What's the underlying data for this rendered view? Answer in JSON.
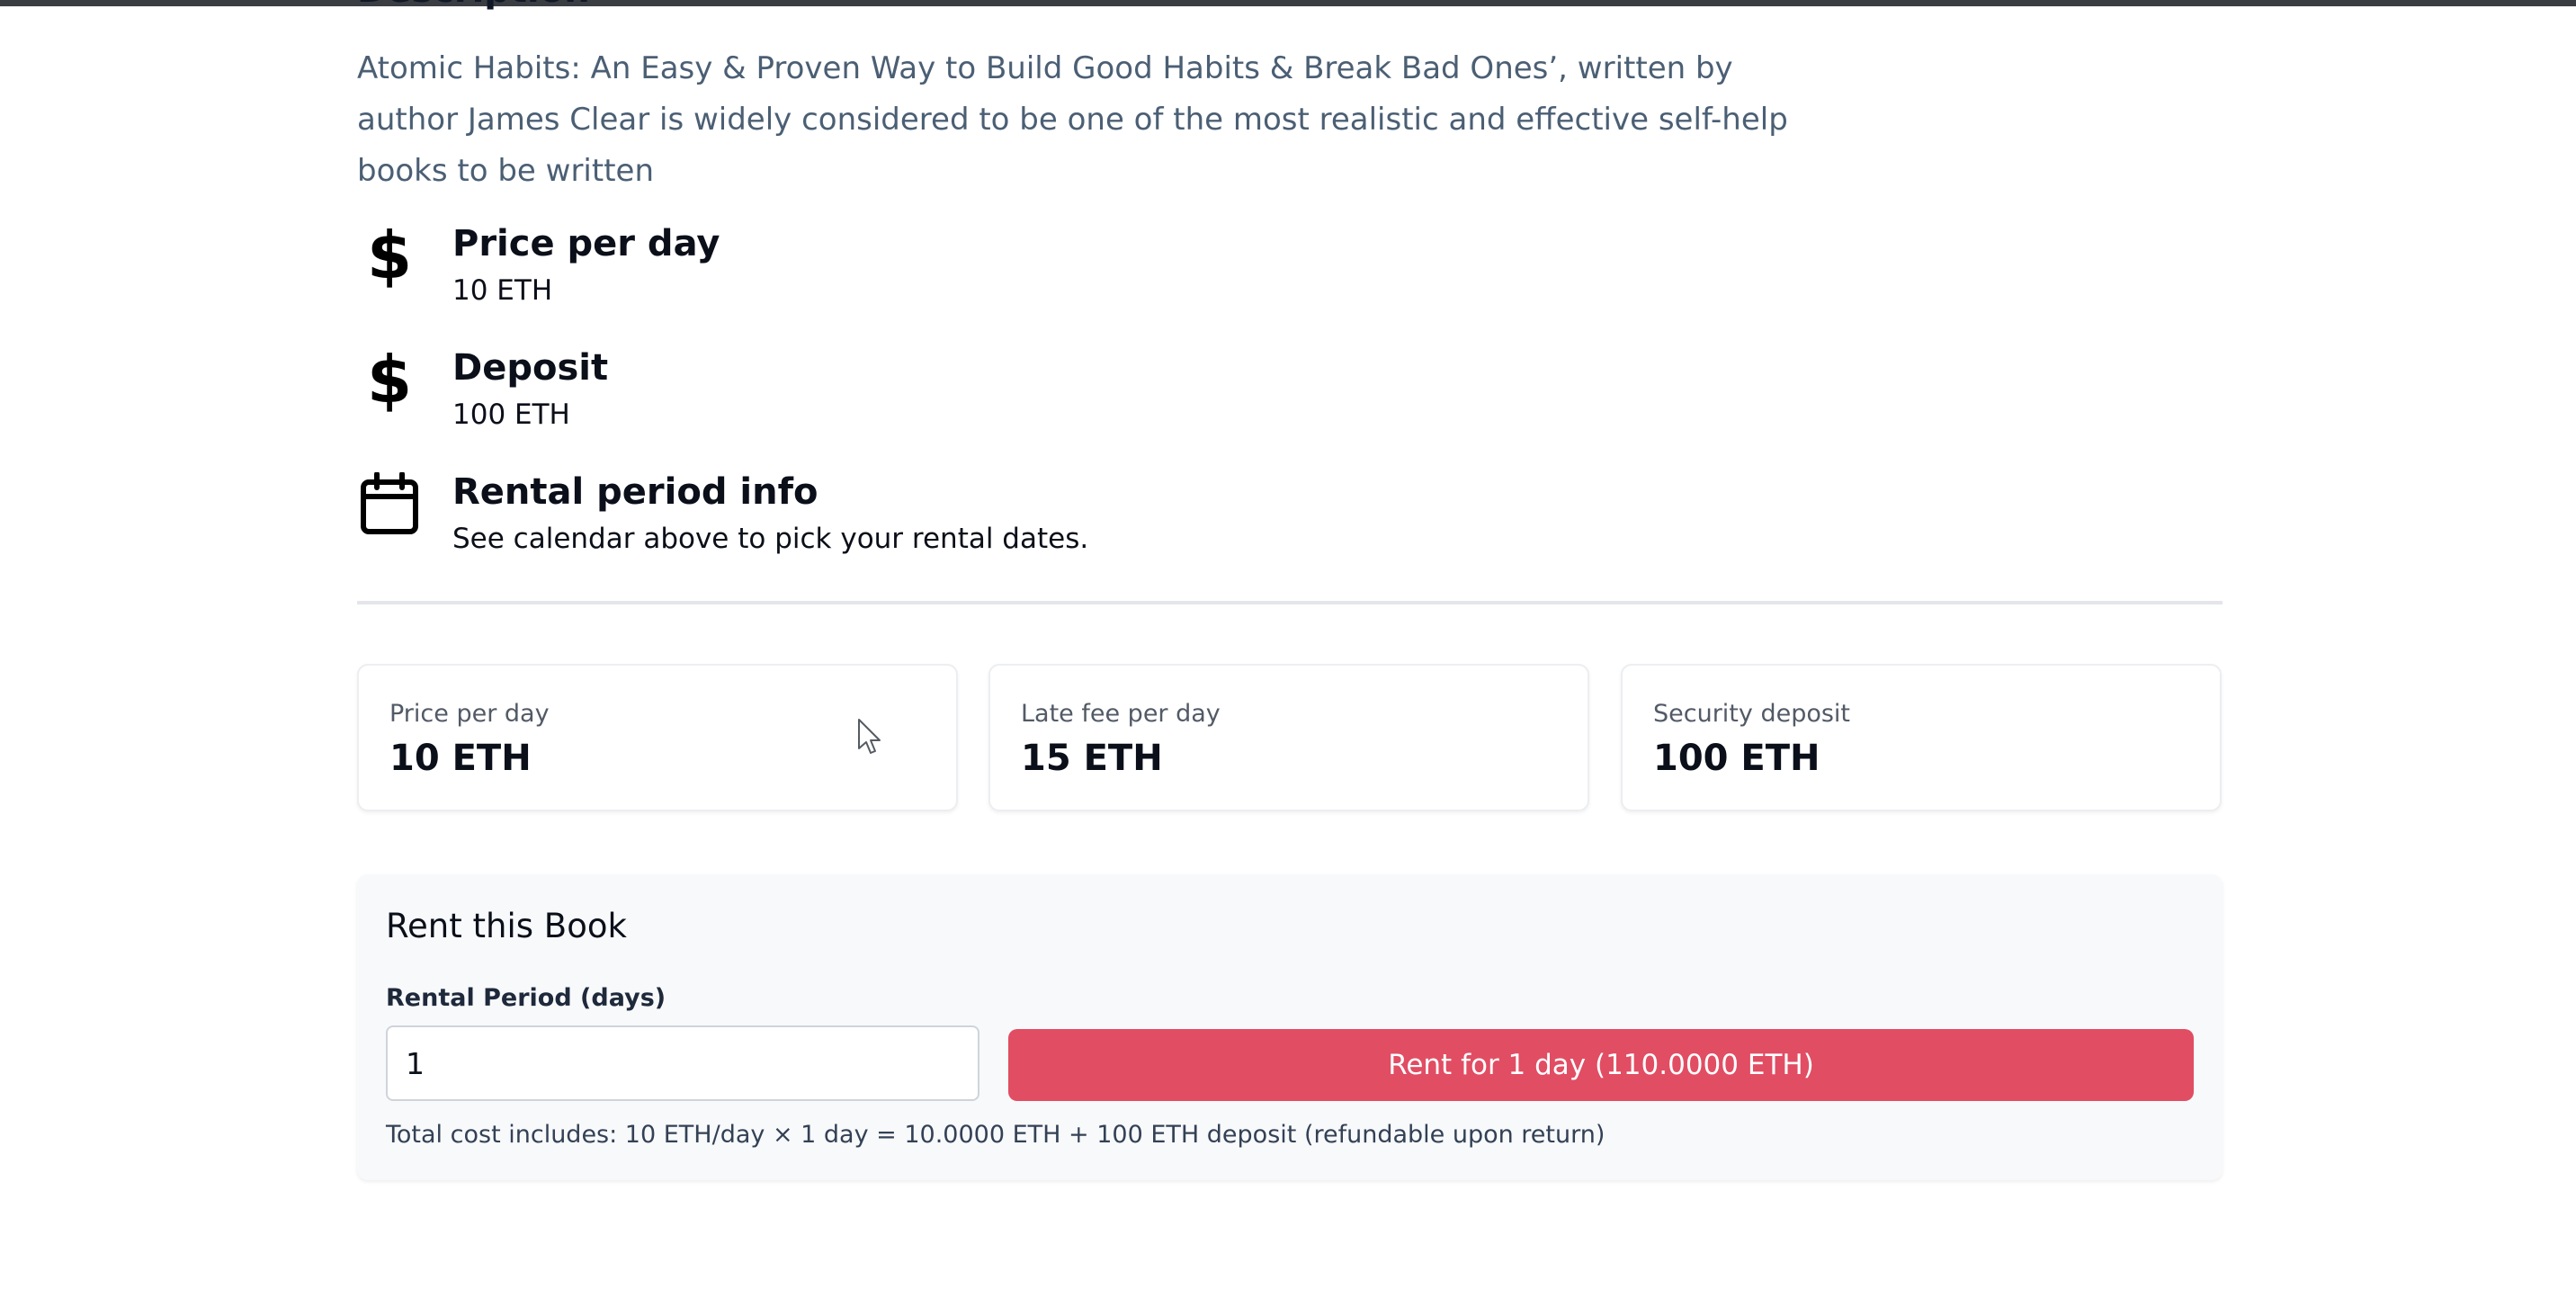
{
  "book": {
    "description": "Atomic Habits: An Easy & Proven Way to Build Good Habits & Break Bad Ones’, written by author James Clear is widely considered to be one of the most realistic and effective self-help books to be written"
  },
  "info": {
    "price": {
      "icon": "dollar-icon",
      "title": "Price per day",
      "value": "10 ETH"
    },
    "deposit": {
      "icon": "dollar-icon",
      "title": "Deposit",
      "value": "100 ETH"
    },
    "rental": {
      "icon": "calendar-icon",
      "title": "Rental period info",
      "value": "See calendar above to pick your rental dates."
    }
  },
  "stats": [
    {
      "label": "Price per day",
      "value": "10 ETH"
    },
    {
      "label": "Late fee per day",
      "value": "15 ETH"
    },
    {
      "label": "Security deposit",
      "value": "100 ETH"
    }
  ],
  "rent": {
    "title": "Rent this Book",
    "period_label": "Rental Period (days)",
    "period_value": "1",
    "button_label": "Rent for 1 day (110.0000 ETH)",
    "note": "Total cost includes: 10 ETH/day × 1 day = 10.0000 ETH + 100 ETH deposit (refundable upon return)"
  },
  "colors": {
    "accent": "#e14d63",
    "description_text": "#4b5f74",
    "panel_bg": "#f8f9fb"
  }
}
